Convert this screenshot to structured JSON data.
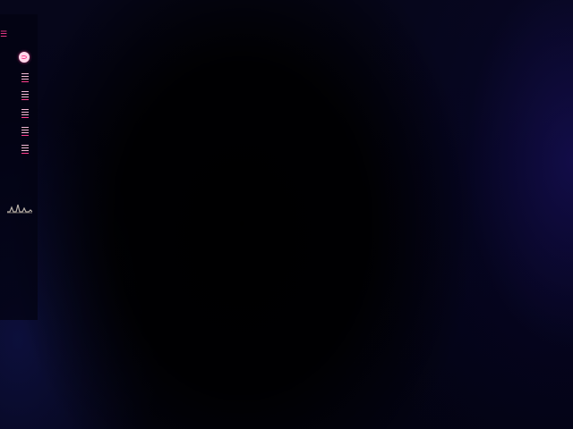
{
  "window": {
    "background_color": "#02020a",
    "accent_color": "#ff3d8f"
  },
  "sidebar": {
    "menu_icon": "menu-icon",
    "items": [
      {
        "name": "nav-home",
        "icon": "home-icon",
        "active": true
      },
      {
        "name": "nav-list-1",
        "icon": "list-icon"
      },
      {
        "name": "nav-list-2",
        "icon": "list-icon"
      },
      {
        "name": "nav-list-3",
        "icon": "list-icon"
      },
      {
        "name": "nav-list-4",
        "icon": "list-icon"
      },
      {
        "name": "nav-list-5",
        "icon": "list-icon"
      }
    ],
    "audio_indicator": {
      "icon": "waveform-icon",
      "color": "#b9b1a8"
    }
  }
}
